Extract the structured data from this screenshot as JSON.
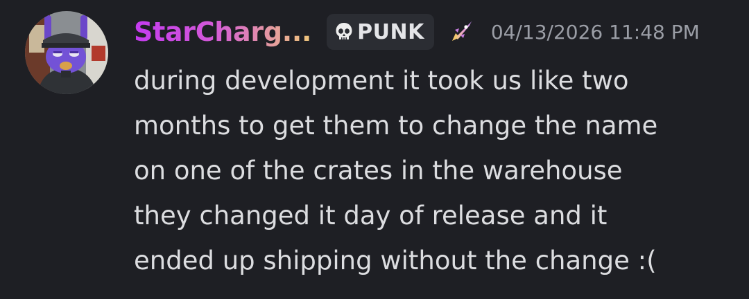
{
  "message": {
    "author": {
      "display_name": "StarCharg...",
      "avatar": "avatar-purple-character-icon"
    },
    "tag": {
      "icon": "skull-icon",
      "label": "PUNK"
    },
    "role_icon": "rocket-icon",
    "timestamp": "04/13/2026 11:48 PM",
    "lines": [
      "during development it took us like two",
      "months to get them to change the name",
      "on one of the crates in the warehouse",
      "they changed it day of release and it",
      "ended up shipping without the change :("
    ]
  },
  "colors": {
    "background": "#1e1f24",
    "name_gradient_start": "#c43bf0",
    "name_gradient_end": "#f0c77a",
    "tag_background": "#2b2d33",
    "message_text": "#dcdde0",
    "timestamp_text": "#9b9ea6"
  }
}
